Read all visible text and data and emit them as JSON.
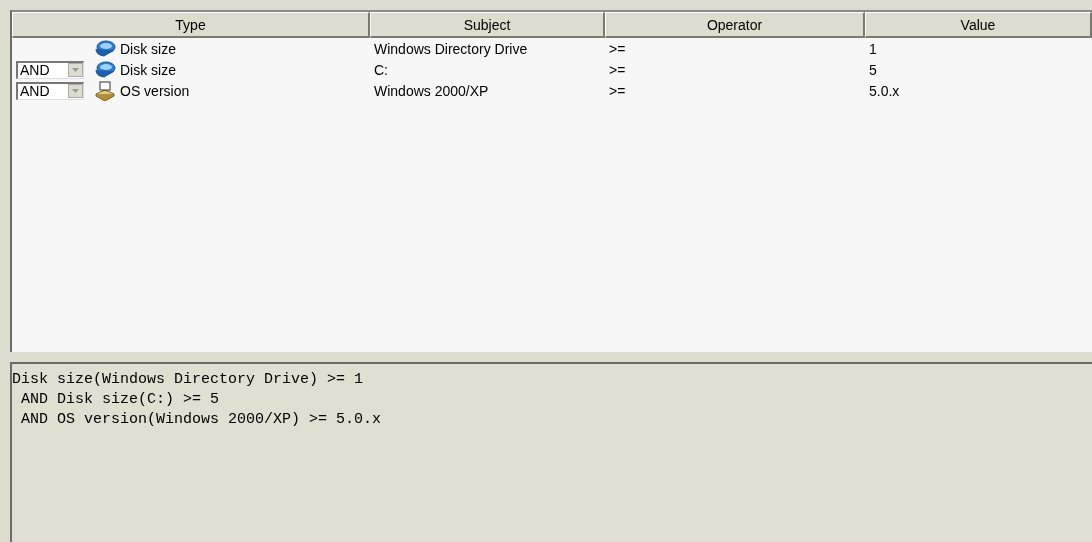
{
  "table": {
    "columns": [
      "Type",
      "Subject",
      "Operator",
      "Value"
    ],
    "rows": [
      {
        "connector": null,
        "kind": "disk",
        "type": "Disk size",
        "subject": "Windows Directory Drive",
        "operator": ">=",
        "value": "1"
      },
      {
        "connector": "AND",
        "kind": "disk",
        "type": "Disk size",
        "subject": "C:",
        "operator": ">=",
        "value": "5"
      },
      {
        "connector": "AND",
        "kind": "os",
        "type": "OS version",
        "subject": "Windows 2000/XP",
        "operator": ">=",
        "value": "5.0.x"
      }
    ]
  },
  "expression": {
    "lines": [
      "Disk size(Windows Directory Drive) >= 1",
      " AND Disk size(C:) >= 5",
      " AND OS version(Windows 2000/XP) >= 5.0.x"
    ]
  }
}
